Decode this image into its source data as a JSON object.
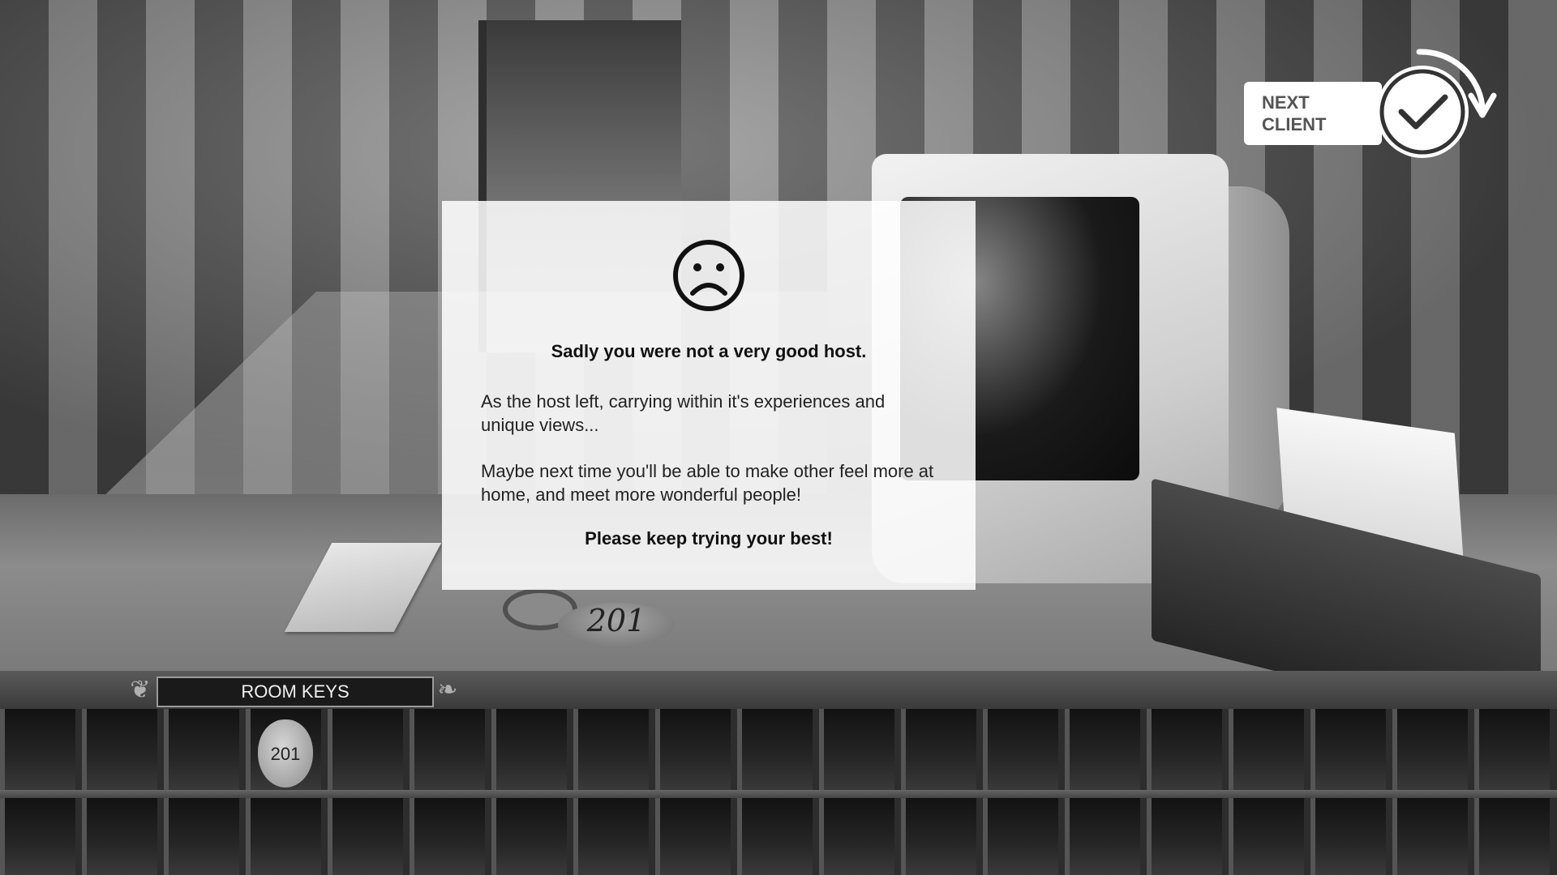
{
  "scene": {
    "desk_key_number": "201"
  },
  "room_keys": {
    "title": "ROOM KEYS",
    "slot_key_number": "201"
  },
  "next_client": {
    "label": "NEXT CLIENT",
    "icon": "check-circle-arrow-icon"
  },
  "dialog": {
    "icon": "sad-face-icon",
    "title": "Sadly you were not a very good host.",
    "paragraph1": "As the host left, carrying within it's experiences and unique views...",
    "paragraph2": "Maybe next time you'll be able to make other feel more at home, and meet more wonderful people!",
    "footer": "Please keep trying your best!"
  },
  "colors": {
    "dialog_bg": "#ffffff",
    "button_bg": "#ffffff",
    "button_text": "#555555",
    "scene_tone": "grayscale"
  }
}
